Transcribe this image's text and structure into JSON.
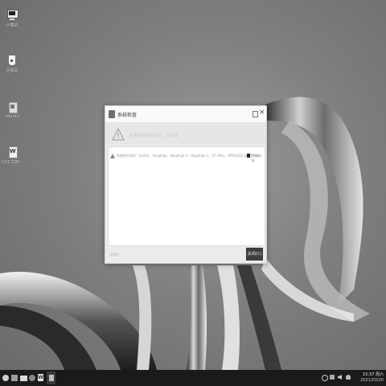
{
  "desktop": {
    "icons": [
      {
        "label": "计算机",
        "icon": "computer-icon"
      },
      {
        "label": "回收站",
        "icon": "trash-icon"
      },
      {
        "label": "ubuntu",
        "icon": "home-folder-icon"
      },
      {
        "label": "DOC文档一",
        "icon": "word-doc-icon"
      }
    ]
  },
  "dialog": {
    "title": "系统检查",
    "header_text": "检测到的问题如下，请处理",
    "message": "系统软件缺失：lynfod、libsgtngs、libsgtngs 1、libsgtngs 3、XT UKm、APP应用无法正常启动",
    "status": "不能修复",
    "footer_left": "请稍候",
    "close_button": "关闭(C)"
  },
  "taskbar": {
    "time": "15:37 周六",
    "date": "2021/03/20"
  }
}
